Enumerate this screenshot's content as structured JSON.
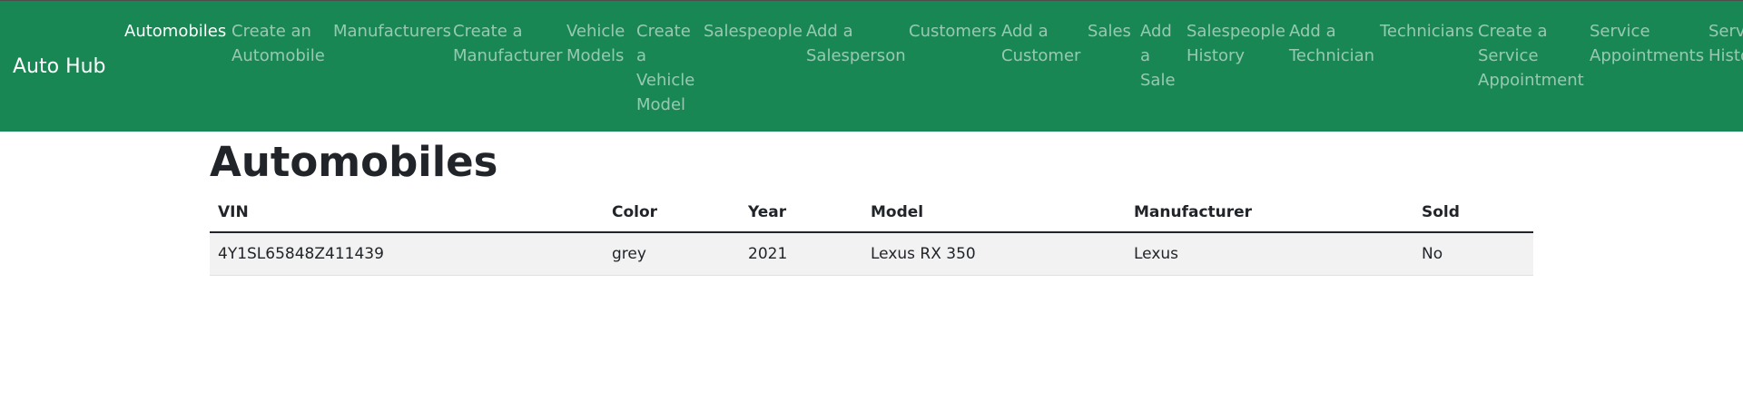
{
  "brand": "Auto Hub",
  "nav": [
    {
      "id": "automobiles",
      "lines": [
        "Automobiles"
      ],
      "active": true
    },
    {
      "id": "create-automobile",
      "lines": [
        "Create an",
        "Automobile"
      ]
    },
    {
      "id": "manufacturers",
      "lines": [
        "Manufacturers"
      ]
    },
    {
      "id": "create-manufacturer",
      "lines": [
        "Create a",
        "Manufacturer"
      ]
    },
    {
      "id": "vehicle-models",
      "lines": [
        "Vehicle",
        "Models"
      ]
    },
    {
      "id": "create-vehicle-model",
      "lines": [
        "Create",
        "a",
        "Vehicle",
        "Model"
      ]
    },
    {
      "id": "salespeople",
      "lines": [
        "Salespeople"
      ]
    },
    {
      "id": "add-salesperson",
      "lines": [
        "Add a",
        "Salesperson"
      ]
    },
    {
      "id": "customers",
      "lines": [
        "Customers"
      ]
    },
    {
      "id": "add-customer",
      "lines": [
        "Add a",
        "Customer"
      ]
    },
    {
      "id": "sales",
      "lines": [
        "Sales"
      ]
    },
    {
      "id": "add-sale",
      "lines": [
        "Add",
        "a",
        "Sale"
      ]
    },
    {
      "id": "salespeople-history",
      "lines": [
        "Salespeople",
        "History"
      ]
    },
    {
      "id": "add-technician",
      "lines": [
        "Add a",
        "Technician"
      ]
    },
    {
      "id": "technicians",
      "lines": [
        "Technicians"
      ]
    },
    {
      "id": "create-service-appointment",
      "lines": [
        "Create a",
        "Service",
        "Appointment"
      ]
    },
    {
      "id": "service-appointments",
      "lines": [
        "Service",
        "Appointments"
      ]
    },
    {
      "id": "service-history",
      "lines": [
        "Service",
        "History"
      ]
    }
  ],
  "page": {
    "title": "Automobiles"
  },
  "table": {
    "headers": [
      "VIN",
      "Color",
      "Year",
      "Model",
      "Manufacturer",
      "Sold"
    ],
    "rows": [
      [
        "4Y1SL65848Z411439",
        "grey",
        "2021",
        "Lexus RX 350",
        "Lexus",
        "No"
      ]
    ]
  }
}
